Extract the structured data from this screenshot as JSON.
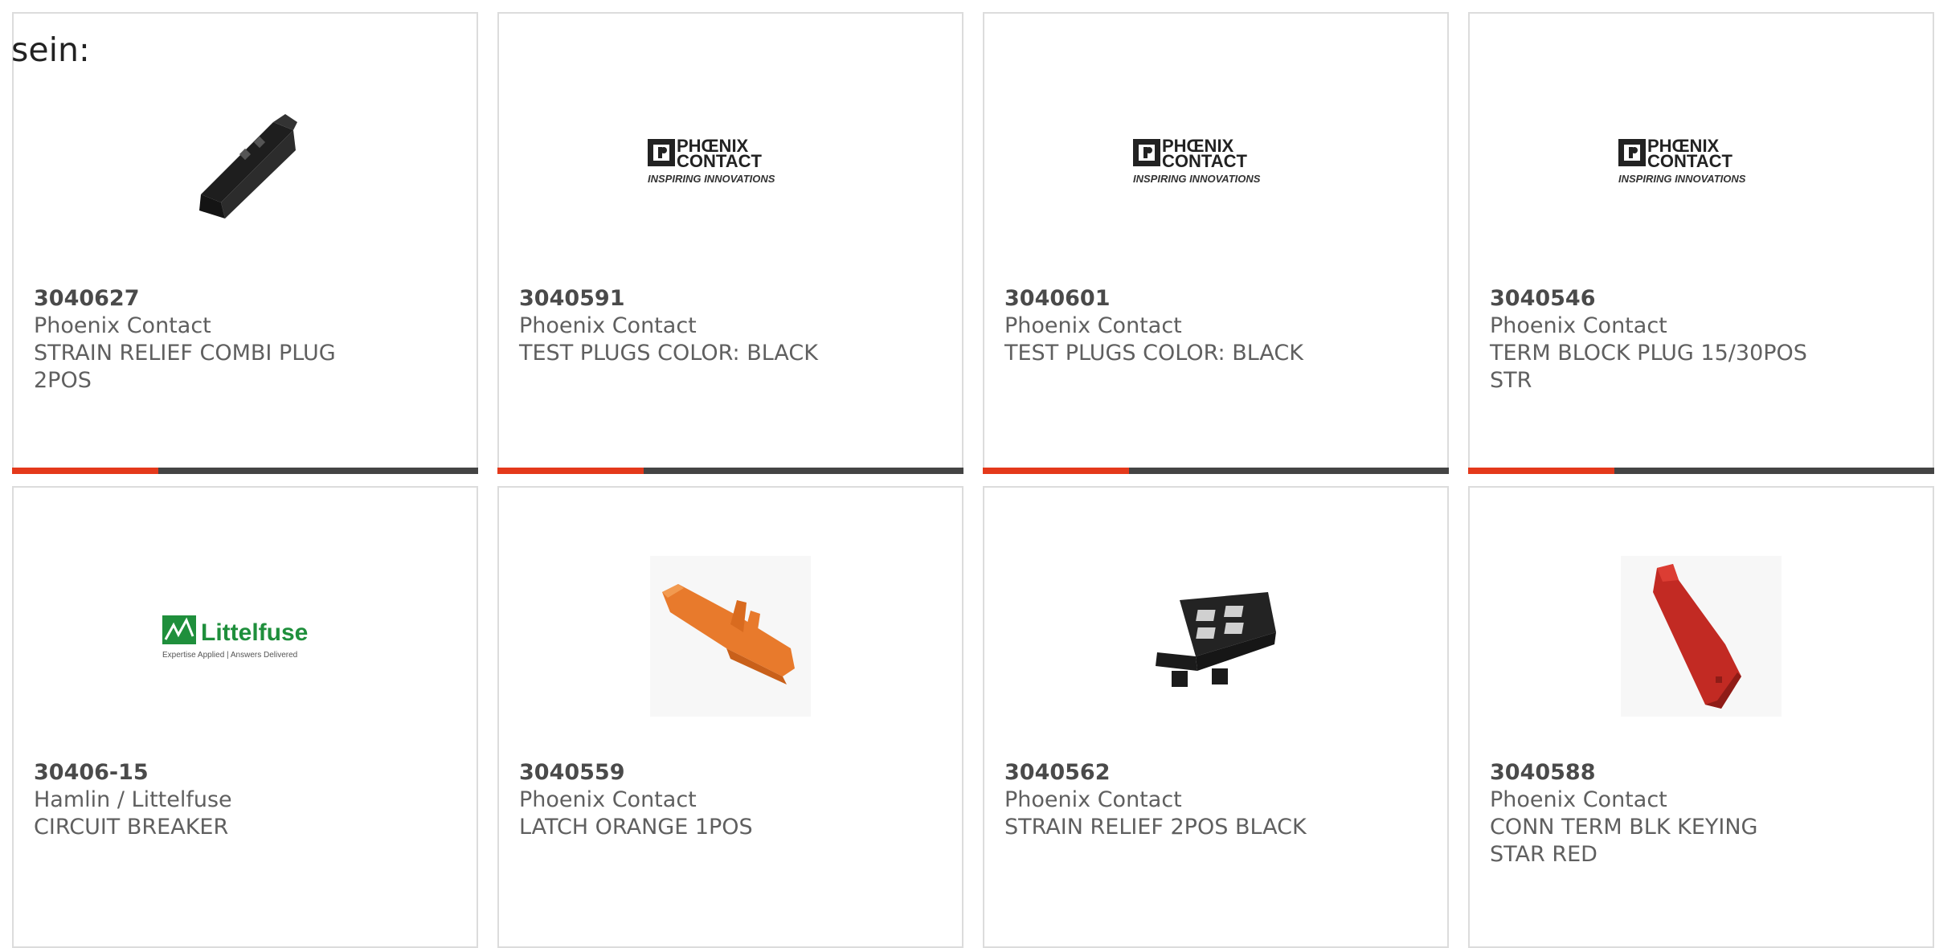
{
  "intro_text": "sein:",
  "colors": {
    "accent": "#e4391b",
    "bar": "#444444",
    "border": "#dcdcdc",
    "text": "#5f5f5f"
  },
  "products": [
    {
      "part_number": "3040627",
      "manufacturer": "Phoenix Contact",
      "description": "STRAIN RELIEF COMBI PLUG 2POS",
      "image": "strain-relief-combi-plug-photo"
    },
    {
      "part_number": "3040591",
      "manufacturer": "Phoenix Contact",
      "description": "TEST PLUGS COLOR: BLACK",
      "image": "phoenix-contact-logo",
      "logo_text": [
        "PHŒNIX",
        "CONTACT",
        "INSPIRING INNOVATIONS"
      ]
    },
    {
      "part_number": "3040601",
      "manufacturer": "Phoenix Contact",
      "description": "TEST PLUGS COLOR: BLACK",
      "image": "phoenix-contact-logo",
      "logo_text": [
        "PHŒNIX",
        "CONTACT",
        "INSPIRING INNOVATIONS"
      ]
    },
    {
      "part_number": "3040546",
      "manufacturer": "Phoenix Contact",
      "description": "TERM BLOCK PLUG 15/30POS STR",
      "image": "phoenix-contact-logo",
      "logo_text": [
        "PHŒNIX",
        "CONTACT",
        "INSPIRING INNOVATIONS"
      ]
    },
    {
      "part_number": "30406-15",
      "manufacturer": "Hamlin / Littelfuse",
      "description": "CIRCUIT BREAKER",
      "image": "littelfuse-logo",
      "logo_text": [
        "Littelfuse",
        "Expertise Applied | Answers Delivered"
      ]
    },
    {
      "part_number": "3040559",
      "manufacturer": "Phoenix Contact",
      "description": "LATCH ORANGE 1POS",
      "image": "orange-latch-photo"
    },
    {
      "part_number": "3040562",
      "manufacturer": "Phoenix Contact",
      "description": "STRAIN RELIEF 2POS BLACK",
      "image": "black-strain-relief-photo"
    },
    {
      "part_number": "3040588",
      "manufacturer": "Phoenix Contact",
      "description": "CONN TERM BLK KEYING STAR RED",
      "image": "red-keying-star-photo"
    }
  ]
}
